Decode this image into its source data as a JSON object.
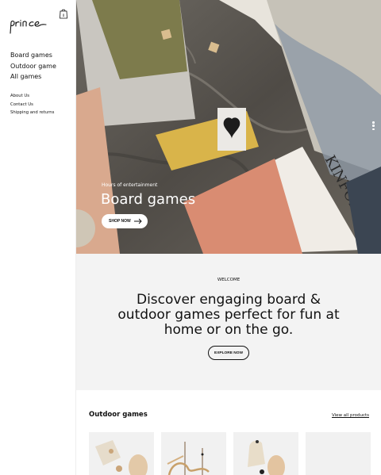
{
  "brand": {
    "logo_text": "prince"
  },
  "sidebar": {
    "main_nav": [
      {
        "label": "Board games"
      },
      {
        "label": "Outdoor game"
      },
      {
        "label": "All games"
      }
    ],
    "secondary_nav": [
      {
        "label": "About Us"
      },
      {
        "label": "Contact Us"
      },
      {
        "label": "Shipping and returns"
      }
    ]
  },
  "hero": {
    "eyebrow": "Hours of entertainment",
    "title": "Board games",
    "button_label": "SHOP NOW",
    "magazine_text": "KINFOLK",
    "slides_count": 3
  },
  "welcome": {
    "eyebrow": "WELCOME",
    "title": "Discover engaging board & outdoor games perfect for fun at home or on the go.",
    "button_label": "EXPLORE NOW"
  },
  "products": {
    "title": "Outdoor games",
    "view_all_label": "View all products"
  },
  "colors": {
    "text": "#111111",
    "welcome_bg": "#f3f3f3",
    "card_bg": "#f1f1f1"
  }
}
